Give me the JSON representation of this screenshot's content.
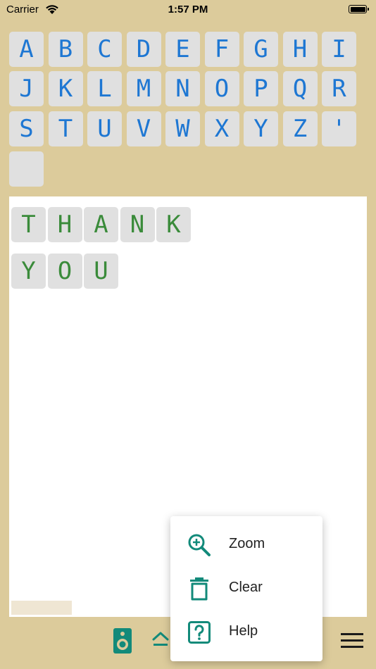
{
  "status_bar": {
    "carrier": "Carrier",
    "time": "1:57 PM"
  },
  "keyboard": {
    "keys": [
      "A",
      "B",
      "C",
      "D",
      "E",
      "F",
      "G",
      "H",
      "I",
      "J",
      "K",
      "L",
      "M",
      "N",
      "O",
      "P",
      "Q",
      "R",
      "S",
      "T",
      "U",
      "V",
      "W",
      "X",
      "Y",
      "Z",
      "'",
      ""
    ]
  },
  "board": {
    "row1": [
      "T",
      "H",
      "A",
      "N",
      "K"
    ],
    "row2": [
      "Y",
      "O",
      "U"
    ]
  },
  "menu": {
    "zoom_label": "Zoom",
    "clear_label": "Clear",
    "help_label": "Help"
  },
  "colors": {
    "background": "#dccb9b",
    "key_text": "#1e77d3",
    "tile_text": "#3a8b3a",
    "accent": "#128a7a"
  },
  "icons": {
    "speaker": "speaker-icon",
    "eject": "eject-icon",
    "menu": "hamburger-menu-icon",
    "zoom": "zoom-in-icon",
    "clear": "trash-icon",
    "help": "help-icon"
  }
}
